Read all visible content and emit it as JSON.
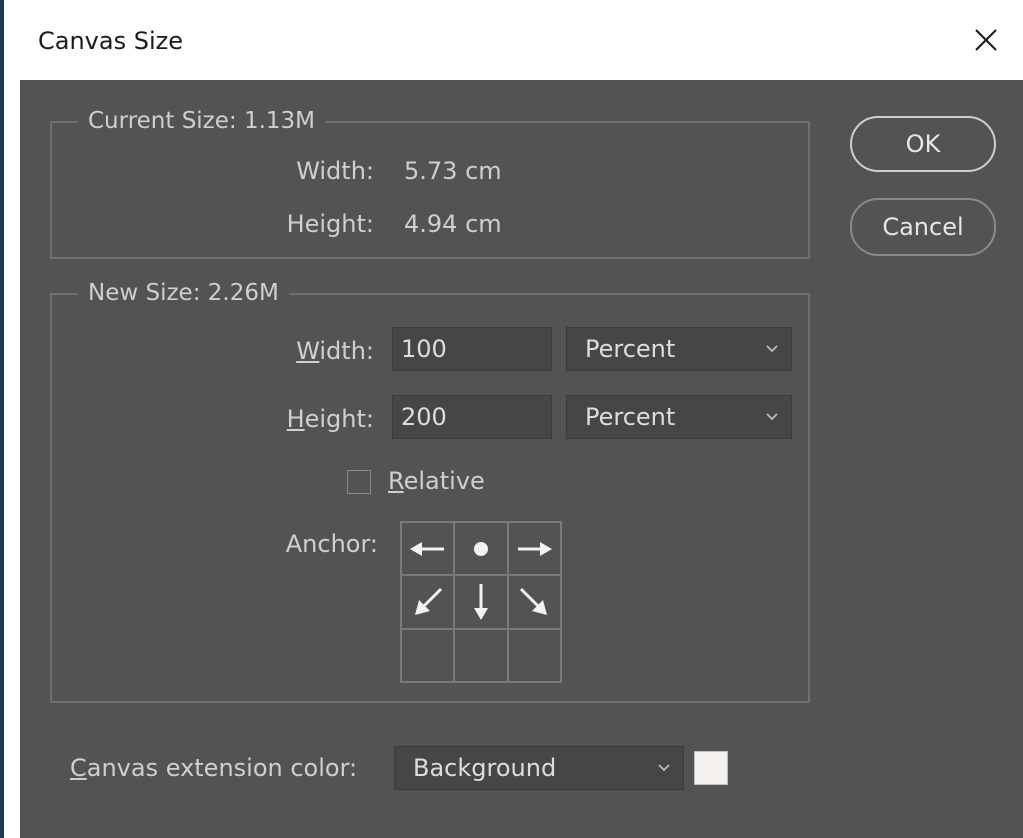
{
  "dialog": {
    "title": "Canvas Size"
  },
  "current_size": {
    "legend": "Current Size: 1.13M",
    "width_label": "Width:",
    "width_value": "5.73 cm",
    "height_label": "Height:",
    "height_value": "4.94 cm"
  },
  "new_size": {
    "legend": "New Size: 2.26M",
    "width_label_key": "W",
    "width_label_rest": "idth:",
    "width_value": "100",
    "width_unit": "Percent",
    "height_label_key": "H",
    "height_label_rest": "eight:",
    "height_value": "200",
    "height_unit": "Percent",
    "relative_key": "R",
    "relative_rest": "elative",
    "relative_checked": false,
    "anchor_label": "Anchor:"
  },
  "buttons": {
    "ok": "OK",
    "cancel": "Cancel"
  },
  "extension": {
    "label_key": "C",
    "label_rest": "anvas extension color:",
    "value": "Background",
    "swatch_color": "#f4f1ee"
  },
  "colors": {
    "panel": "#535353",
    "field": "#464646",
    "text": "#cfcfcf"
  },
  "icons": {
    "anchor": [
      "arrow-left-icon",
      "anchor-center-dot-icon",
      "arrow-right-icon",
      "arrow-down-left-icon",
      "arrow-down-icon",
      "arrow-down-right-icon",
      "",
      "",
      ""
    ]
  }
}
